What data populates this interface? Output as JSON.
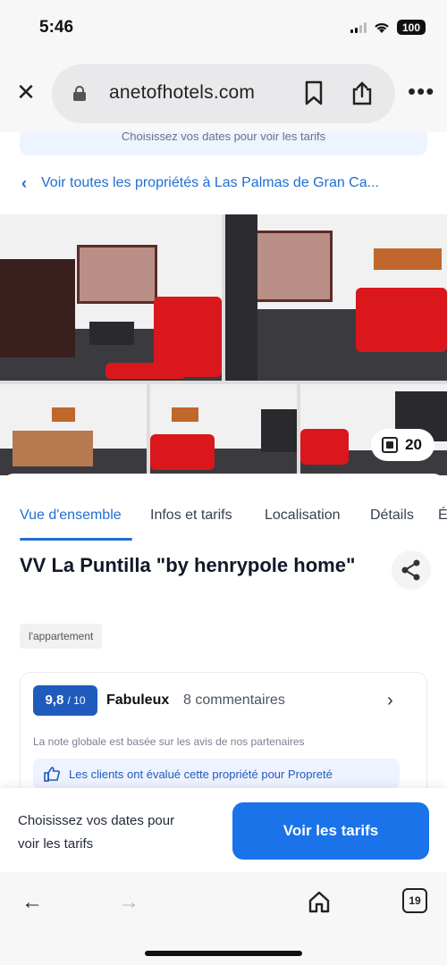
{
  "status_bar": {
    "time": "5:46",
    "battery": "100"
  },
  "browser": {
    "url": "anetofhotels.com",
    "open_tabs": "19"
  },
  "date_banner": "Choisissez vos dates pour voir les tarifs",
  "back_link": "Voir toutes les propriétés à Las Palmas de Gran Ca...",
  "gallery": {
    "photo_count": "20"
  },
  "tabs": [
    {
      "label": "Vue d'ensemble",
      "active": true
    },
    {
      "label": "Infos et tarifs"
    },
    {
      "label": "Localisation"
    },
    {
      "label": "Détails"
    },
    {
      "label": "É"
    }
  ],
  "property": {
    "title": "VV La Puntilla \"by henrypole home\"",
    "type": "l'appartement"
  },
  "rating": {
    "score": "9,8",
    "score_max": "/ 10",
    "word": "Fabuleux",
    "reviews": "8 commentaires",
    "note": "La note globale est basée sur les avis de nos partenaires",
    "highlight": "Les clients ont évalué cette propriété pour Propreté"
  },
  "cta": {
    "text": "Choisissez vos dates pour voir les tarifs",
    "button": "Voir les tarifs"
  },
  "colors": {
    "accent": "#1a73e8",
    "score_badge": "#1f5bbd",
    "link": "#1f6ed4"
  }
}
